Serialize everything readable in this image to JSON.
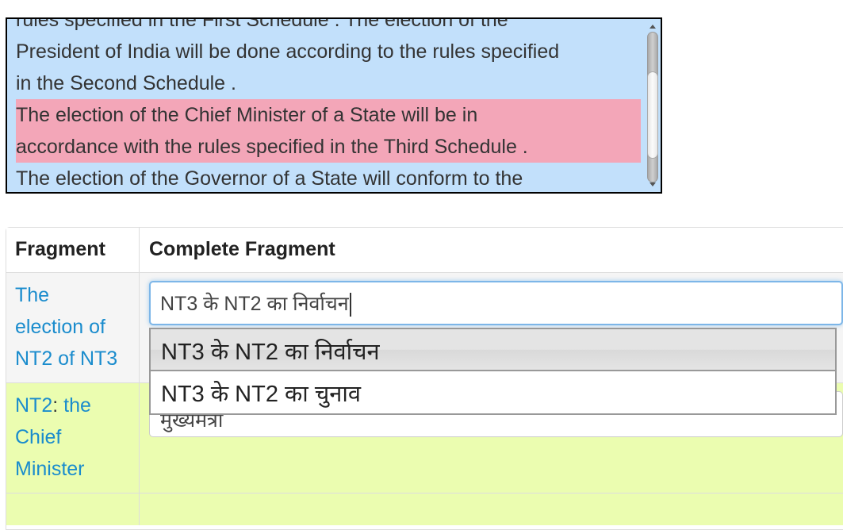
{
  "source_text": {
    "segments": [
      {
        "text": "rules specified in the First Schedule . The election of the",
        "highlight": false
      },
      {
        "text": "President of India will be done according to the rules specified",
        "highlight": false
      },
      {
        "text": "in the Second Schedule .",
        "highlight": false
      },
      {
        "text": "The election of the Chief Minister of a State will be in",
        "highlight": true
      },
      {
        "text": "accordance with the rules specified in the Third Schedule .",
        "highlight": true
      },
      {
        "text": "The election of the Governor of a State will conform to the",
        "highlight": false
      }
    ],
    "background_color": "#c2e0fb",
    "highlight_color": "#f3a6b8"
  },
  "table": {
    "headers": [
      "Fragment",
      "Complete Fragment"
    ],
    "rows": [
      {
        "fragment_lines": [
          "The",
          "election of",
          "NT2 of NT3"
        ],
        "input_value": "NT3 के NT2 का निर्वाचन",
        "focused": true,
        "background_color": "#f5f5f5"
      },
      {
        "fragment_parts": {
          "nt": "NT2",
          "sep": ":",
          "lines": [
            " the",
            "Chief",
            "Minister"
          ]
        },
        "input_value": "मुख्यमंत्री",
        "focused": false,
        "background_color": "#ebfdb0"
      }
    ]
  },
  "autocomplete": {
    "options": [
      "NT3 के NT2 का निर्वाचन",
      "NT3 के NT2 का चुनाव"
    ],
    "active_index": 0
  },
  "colors": {
    "link": "#1a8ccd",
    "focus_border": "#7db6e8"
  }
}
